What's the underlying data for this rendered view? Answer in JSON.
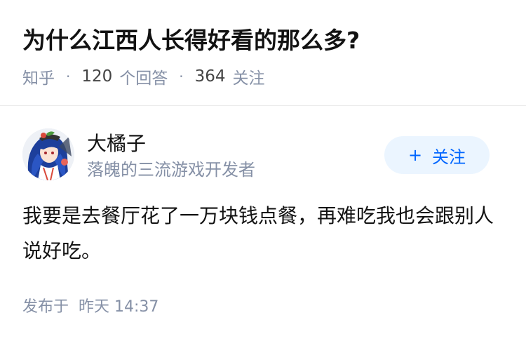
{
  "question": {
    "title": "为什么江西人长得好看的那么多?",
    "source": "知乎",
    "answer_count": "120",
    "answer_label": "个回答",
    "follower_count": "364",
    "follower_label": "关注"
  },
  "answer": {
    "author": {
      "name": "大橘子",
      "bio": "落魄的三流游戏开发者"
    },
    "follow_button": {
      "icon": "+",
      "label": "关注"
    },
    "content": "我要是去餐厅花了一万块钱点餐，再难吃我也会跟别人说好吃。",
    "time": {
      "label": "发布于",
      "value": "昨天 14:37"
    }
  },
  "colors": {
    "text_primary": "#121212",
    "text_secondary": "#8590a6",
    "accent": "#0066ff",
    "follow_bg": "#ebf5ff",
    "divider": "#ebebeb"
  }
}
